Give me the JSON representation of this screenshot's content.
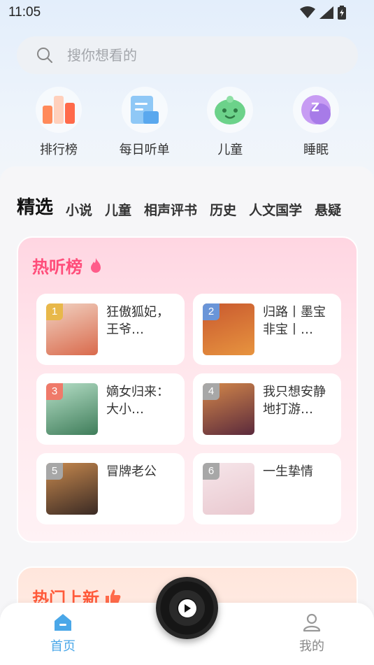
{
  "status": {
    "time": "11:05"
  },
  "search": {
    "placeholder": "搜你想看的"
  },
  "quick": [
    {
      "label": "排行榜",
      "icon": "ranking-icon"
    },
    {
      "label": "每日听单",
      "icon": "daily-list-icon"
    },
    {
      "label": "儿童",
      "icon": "children-icon"
    },
    {
      "label": "睡眠",
      "icon": "sleep-icon"
    }
  ],
  "tabs": [
    "精选",
    "小说",
    "儿童",
    "相声评书",
    "历史",
    "人文国学",
    "悬疑"
  ],
  "hot": {
    "title": "热听榜",
    "items": [
      {
        "rank": "1",
        "title": "狂傲狐妃，王爷…",
        "badge": "#e8b84a",
        "cover": [
          "#d96a4c",
          "#f1d2c2"
        ]
      },
      {
        "rank": "2",
        "title": "归路丨墨宝非宝丨…",
        "badge": "#6a95d8",
        "cover": [
          "#e7943f",
          "#c9592f"
        ]
      },
      {
        "rank": "3",
        "title": "嫡女归来：大小…",
        "badge": "#ef7a6a",
        "cover": [
          "#3f7d5a",
          "#b6dfc7"
        ]
      },
      {
        "rank": "4",
        "title": "我只想安静地打游…",
        "badge": "#a7a7a7",
        "cover": [
          "#5b2a3c",
          "#d3874a"
        ]
      },
      {
        "rank": "5",
        "title": "冒牌老公",
        "badge": "#a7a7a7",
        "cover": [
          "#3a2a24",
          "#c7894e"
        ]
      },
      {
        "rank": "6",
        "title": "一生挚情",
        "badge": "#a7a7a7",
        "cover": [
          "#e9c8cf",
          "#f6e6ea"
        ]
      }
    ]
  },
  "new_section": {
    "title": "热门上新"
  },
  "nav": {
    "home": "首页",
    "mine": "我的"
  },
  "colors": {
    "accent": "#4aa7e8",
    "hot": "#ff4d7a",
    "new": "#ff5a3a"
  }
}
